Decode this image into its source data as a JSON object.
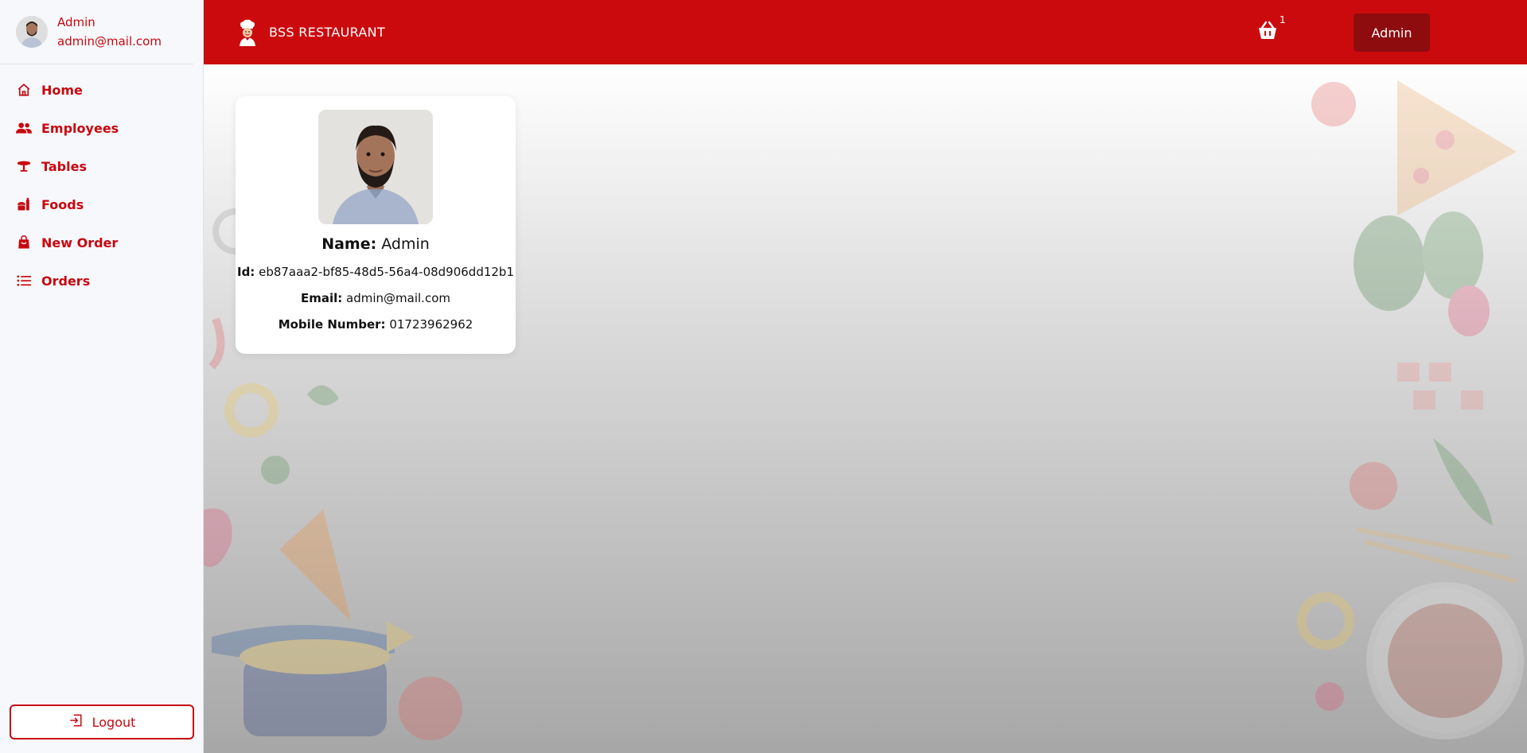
{
  "sidebar": {
    "user": {
      "name": "Admin",
      "email": "admin@mail.com"
    },
    "items": [
      {
        "label": "Home",
        "icon": "home-icon"
      },
      {
        "label": "Employees",
        "icon": "people-icon"
      },
      {
        "label": "Tables",
        "icon": "table-icon"
      },
      {
        "label": "Foods",
        "icon": "food-icon"
      },
      {
        "label": "New Order",
        "icon": "shopping-bag-icon"
      },
      {
        "label": "Orders",
        "icon": "list-icon"
      }
    ],
    "logout_label": "Logout"
  },
  "header": {
    "brand": "BSS RESTAURANT",
    "admin_button": "Admin",
    "cart_count": "1"
  },
  "profile_card": {
    "name_label": "Name:",
    "name": "Admin",
    "id_label": "Id:",
    "id": "eb87aaa2-bf85-48d5-56a4-08d906dd12b1",
    "email_label": "Email:",
    "email": "admin@mail.com",
    "mobile_label": "Mobile Number:",
    "mobile": "01723962962"
  },
  "colors": {
    "brand": "#cb0a0e",
    "accent_dark": "#8e0b0e",
    "sidebar_text": "#c8070f"
  }
}
